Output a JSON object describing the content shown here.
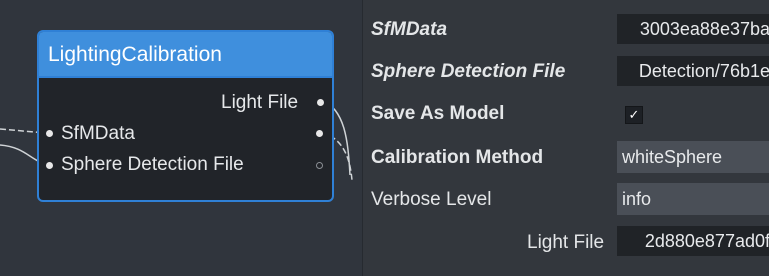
{
  "node": {
    "title": "LightingCalibration",
    "outputs": [
      {
        "label": "Light File"
      }
    ],
    "inputs": [
      {
        "label": "SfMData"
      },
      {
        "label": "Sphere Detection File"
      }
    ]
  },
  "editor": {
    "rows": [
      {
        "label": "SfMData",
        "value": "3003ea88e37ba"
      },
      {
        "label": "Sphere Detection File",
        "value": "Detection/76b1e"
      },
      {
        "label": "Save As Model",
        "checked": true,
        "check_glyph": "✓"
      },
      {
        "label": "Calibration Method",
        "value": "whiteSphere"
      },
      {
        "label": "Verbose Level",
        "value": "info"
      },
      {
        "label": "Light File",
        "value": "2d880e877ad0f"
      }
    ]
  },
  "colors": {
    "accent": "#3f8fdd",
    "node_body": "#212429",
    "panel_bg": "#33373d"
  }
}
